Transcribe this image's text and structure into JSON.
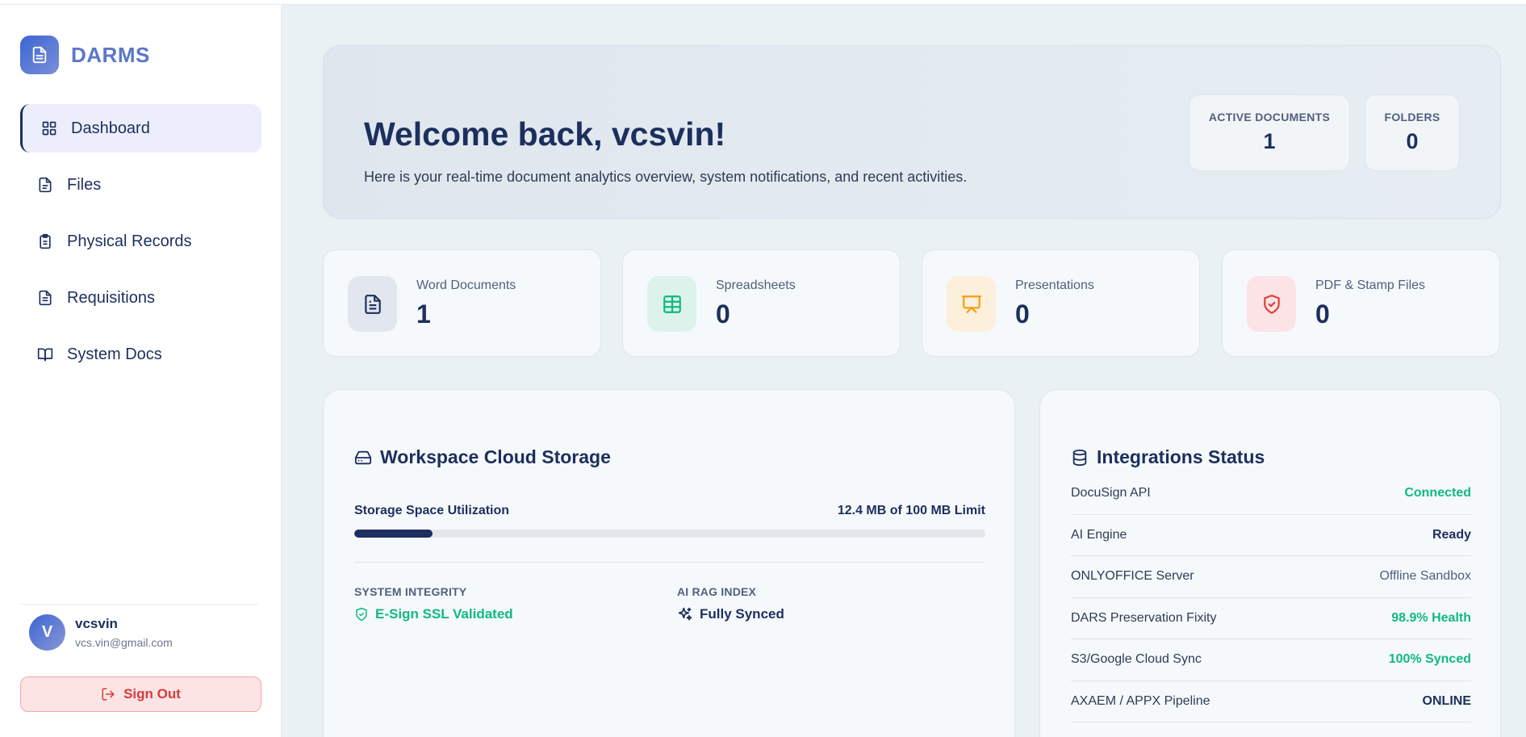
{
  "app": {
    "name": "DARMS"
  },
  "sidebar": {
    "items": [
      {
        "label": "Dashboard",
        "icon": "grid-icon",
        "active": true
      },
      {
        "label": "Files",
        "icon": "file-icon"
      },
      {
        "label": "Physical Records",
        "icon": "clipboard-icon"
      },
      {
        "label": "Requisitions",
        "icon": "file-text-icon"
      },
      {
        "label": "System Docs",
        "icon": "book-icon"
      }
    ]
  },
  "user": {
    "initial": "V",
    "name": "vcsvin",
    "email": "vcs.vin@gmail.com",
    "signout_label": "Sign Out"
  },
  "welcome": {
    "title": "Welcome back, vcsvin!",
    "subtitle": "Here is your real-time document analytics overview, system notifications, and recent activities.",
    "counters": [
      {
        "label": "ACTIVE DOCUMENTS",
        "value": "1"
      },
      {
        "label": "FOLDERS",
        "value": "0"
      }
    ]
  },
  "stats": [
    {
      "label": "Word Documents",
      "value": "1",
      "icon": "document-icon",
      "color": "#1c2f5e",
      "bg": "#e2e7ef"
    },
    {
      "label": "Spreadsheets",
      "value": "0",
      "icon": "table-icon",
      "color": "#10b981",
      "bg": "#dcf3ec"
    },
    {
      "label": "Presentations",
      "value": "0",
      "icon": "presentation-icon",
      "color": "#f59e0b",
      "bg": "#fcefdc"
    },
    {
      "label": "PDF & Stamp Files",
      "value": "0",
      "icon": "shield-check-icon",
      "color": "#e23b3b",
      "bg": "#fbe3e6"
    }
  ],
  "storage": {
    "title": "Workspace Cloud Storage",
    "util_label": "Storage Space Utilization",
    "util_value": "12.4 MB of 100 MB Limit",
    "used_fraction": 0.124,
    "integrity_label": "SYSTEM INTEGRITY",
    "integrity_value": "E-Sign SSL Validated",
    "rag_label": "AI RAG INDEX",
    "rag_value": "Fully Synced"
  },
  "integrations": {
    "title": "Integrations Status",
    "rows": [
      {
        "name": "DocuSign API",
        "status": "Connected",
        "color": "#10b981"
      },
      {
        "name": "AI Engine",
        "status": "Ready",
        "color": "#1c2f5e"
      },
      {
        "name": "ONLYOFFICE Server",
        "status": "Offline Sandbox",
        "color": "#506080"
      },
      {
        "name": "DARS Preservation Fixity",
        "status": "98.9% Health",
        "color": "#10b981"
      },
      {
        "name": "S3/Google Cloud Sync",
        "status": "100% Synced",
        "color": "#10b981"
      },
      {
        "name": "AXAEM / APPX Pipeline",
        "status": "ONLINE",
        "color": "#1c2f5e"
      }
    ]
  },
  "colors": {
    "primary": "#1c2f5e",
    "accent": "#3b66d4",
    "success": "#10b981",
    "danger": "#d83b3b"
  }
}
